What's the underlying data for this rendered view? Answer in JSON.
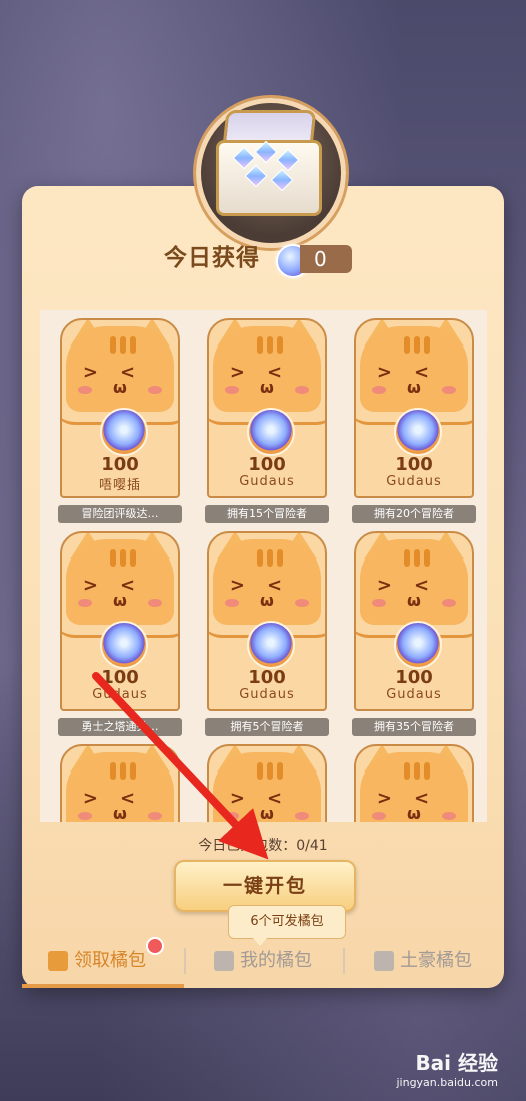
{
  "header": {
    "today_title": "今日获得",
    "today_count": "0"
  },
  "cards": [
    {
      "amount": "100",
      "sender": "唔嘤插",
      "condition": "冒险团评级达…"
    },
    {
      "amount": "100",
      "sender": "Gudaus",
      "condition": "拥有15个冒险者"
    },
    {
      "amount": "100",
      "sender": "Gudaus",
      "condition": "拥有20个冒险者"
    },
    {
      "amount": "100",
      "sender": "Gudaus",
      "condition": "勇士之塔通关…"
    },
    {
      "amount": "100",
      "sender": "Gudaus",
      "condition": "拥有5个冒险者"
    },
    {
      "amount": "100",
      "sender": "Gudaus",
      "condition": "拥有35个冒险者"
    }
  ],
  "progress_text": "今日已开包数：0/41",
  "open_all_label": "一键开包",
  "tip_text": "6个可发橘包",
  "tabs": [
    {
      "label": "领取橘包"
    },
    {
      "label": "我的橘包"
    },
    {
      "label": "土豪橘包"
    }
  ],
  "watermark": {
    "logo": "Bai 经验",
    "site": "jingyan.baidu.com"
  },
  "colors": {
    "accent": "#e49a46",
    "panel": "#fbe0b6",
    "arrow": "#e8271e"
  }
}
